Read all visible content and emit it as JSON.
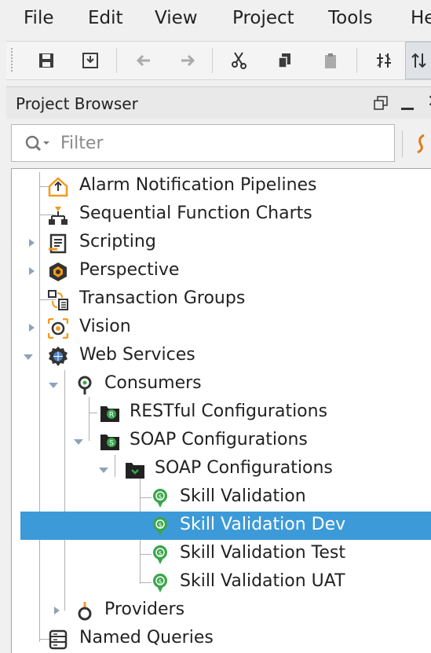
{
  "menubar": {
    "items": [
      "File",
      "Edit",
      "View",
      "Project",
      "Tools",
      "He"
    ]
  },
  "toolbar": {
    "buttons": [
      "save-icon",
      "save-as-icon",
      "undo-icon",
      "redo-icon",
      "cut-icon",
      "copy-icon",
      "paste-icon",
      "compare-icon",
      "sort-icon"
    ]
  },
  "panel": {
    "title": "Project Browser",
    "filter_placeholder": "Filter"
  },
  "tree": {
    "items": [
      {
        "label": "Alarm Notification Pipelines",
        "icon": "alarm-pipeline-icon"
      },
      {
        "label": "Sequential Function Charts",
        "icon": "sfc-icon"
      },
      {
        "label": "Scripting",
        "icon": "scripting-icon"
      },
      {
        "label": "Perspective",
        "icon": "perspective-icon"
      },
      {
        "label": "Transaction Groups",
        "icon": "transaction-groups-icon"
      },
      {
        "label": "Vision",
        "icon": "vision-icon"
      },
      {
        "label": "Web Services",
        "icon": "web-services-icon"
      },
      {
        "label": "Consumers",
        "icon": "consumers-icon"
      },
      {
        "label": "RESTful Configurations",
        "icon": "restful-config-icon"
      },
      {
        "label": "SOAP Configurations",
        "icon": "soap-config-icon"
      },
      {
        "label": "SOAP Configurations",
        "icon": "folder-icon"
      },
      {
        "label": "Skill Validation",
        "icon": "soap-service-icon"
      },
      {
        "label": "Skill Validation Dev",
        "icon": "soap-service-icon",
        "selected": true
      },
      {
        "label": "Skill Validation Test",
        "icon": "soap-service-icon"
      },
      {
        "label": "Skill Validation UAT",
        "icon": "soap-service-icon"
      },
      {
        "label": "Providers",
        "icon": "providers-icon"
      },
      {
        "label": "Named Queries",
        "icon": "named-queries-icon"
      }
    ]
  },
  "colors": {
    "selection": "#3d9ad8",
    "soap_green": "#3aa64a",
    "alarm_orange": "#f39a1e"
  }
}
